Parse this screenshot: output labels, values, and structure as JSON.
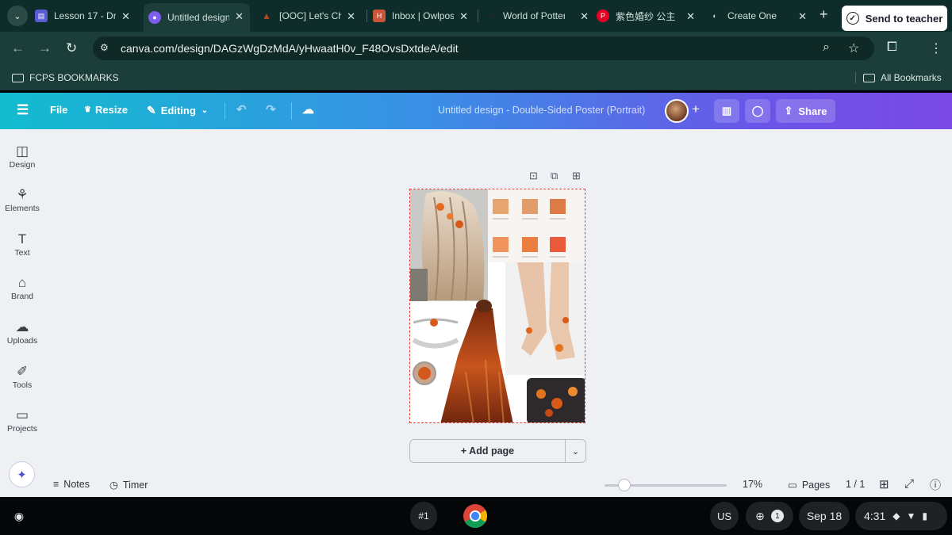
{
  "browser": {
    "tabs": [
      {
        "title": "Lesson 17 - Dr",
        "color": "#5b5bd6"
      },
      {
        "title": "Untitled design",
        "color": "#7d5cf0",
        "active": true
      },
      {
        "title": "[OOC] Let's Ch",
        "color": "#b3461e"
      },
      {
        "title": "Inbox | Owlpost",
        "color": "#c9553a"
      },
      {
        "title": "World of Potter",
        "color": "#4a1d1d"
      },
      {
        "title": "紫色婚纱 公主",
        "color": "#e60023"
      },
      {
        "title": "Create One",
        "color": "#5f6b6a"
      }
    ],
    "url": "canva.com/design/DAGzWgDzMdA/yHwaatH0v_F48OvsDxtdeA/edit",
    "bookmarks": {
      "left": "FCPS BOOKMARKS",
      "right": "All Bookmarks"
    }
  },
  "canva": {
    "menu": {
      "file": "File",
      "resize": "Resize",
      "editing": "Editing"
    },
    "doc_title": "Untitled design - Double-Sided Poster (Portrait)",
    "share": "Share",
    "send": "Send to teacher",
    "sidebar": [
      {
        "label": "Design",
        "icon": "design-icon"
      },
      {
        "label": "Elements",
        "icon": "elements-icon"
      },
      {
        "label": "Text",
        "icon": "text-icon"
      },
      {
        "label": "Brand",
        "icon": "brand-icon"
      },
      {
        "label": "Uploads",
        "icon": "uploads-icon"
      },
      {
        "label": "Tools",
        "icon": "tools-icon"
      },
      {
        "label": "Projects",
        "icon": "projects-icon"
      }
    ],
    "add_page": "+ Add page",
    "footer": {
      "notes": "Notes",
      "timer": "Timer",
      "zoom": "17%",
      "pages": "Pages",
      "page_count": "1 / 1",
      "zoom_level": 0.17
    },
    "palette": [
      "#e6a56e",
      "#e29d6a",
      "#de7a43",
      "#f0935c",
      "#ec7f3f",
      "#e85a3a"
    ]
  },
  "shelf": {
    "launcher_badge": "#1",
    "locale": "US",
    "notif_count": "1",
    "date": "Sep 18",
    "time": "4:31"
  }
}
